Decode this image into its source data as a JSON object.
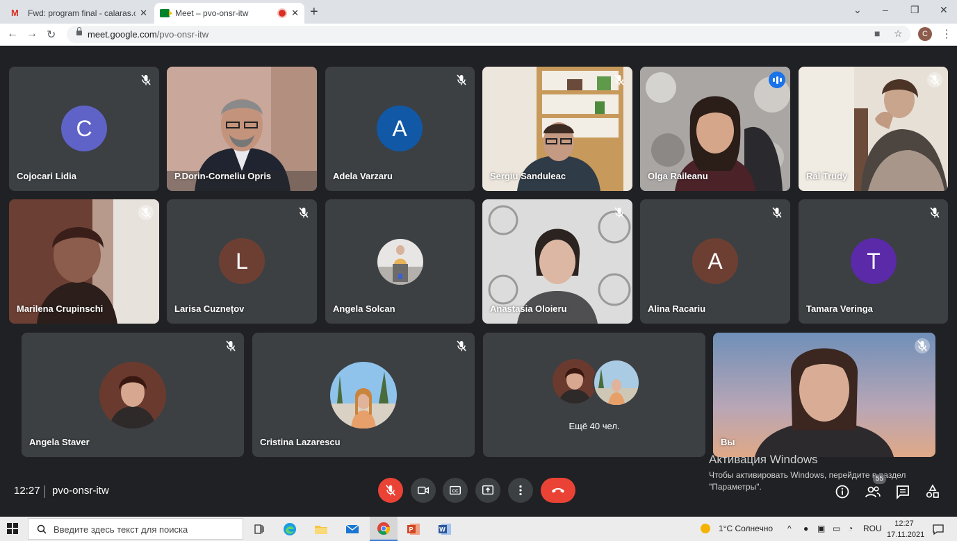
{
  "browser": {
    "tabs": [
      {
        "title": "Fwd: program final - calaras.carol"
      },
      {
        "title": "Meet – pvo-onsr-itw"
      }
    ],
    "url_host": "meet.google.com",
    "url_path": "/pvo-onsr-itw",
    "profile_initial": "C"
  },
  "meet": {
    "tiles": [
      {
        "name": "Cojocari Lidia",
        "initial": "C",
        "color": "#5f63c8"
      },
      {
        "name": "P.Dorin-Corneliu Opris"
      },
      {
        "name": "Adela Varzaru",
        "initial": "A",
        "color": "#1158a7"
      },
      {
        "name": "Sergiu Sanduleac"
      },
      {
        "name": "Olga Raileanu",
        "speaking": true
      },
      {
        "name": "Ral Trudy"
      },
      {
        "name": "Marilena Crupinschi"
      },
      {
        "name": "Larisa Cuznețov",
        "initial": "L",
        "color": "#6d3f33"
      },
      {
        "name": "Angela Solcan"
      },
      {
        "name": "Anastasia Oloieru"
      },
      {
        "name": "Alina Racariu",
        "initial": "A",
        "color": "#6d3f33"
      },
      {
        "name": "Tamara Veringa",
        "initial": "T",
        "color": "#5a2aa8"
      },
      {
        "name": "Angela Staver"
      },
      {
        "name": "Cristina Lazarescu"
      },
      {
        "more_label": "Ещё 40 чел."
      },
      {
        "name": "Вы"
      }
    ],
    "time": "12:27",
    "meeting_code": "pvo-onsr-itw",
    "participants_count": "55",
    "controls": [
      "mic-off",
      "camera",
      "captions",
      "present",
      "more",
      "hang-up"
    ]
  },
  "watermark": {
    "title": "Активация Windows",
    "line1": "Чтобы активировать Windows, перейдите в раздел",
    "line2": "\"Параметры\"."
  },
  "taskbar": {
    "search_placeholder": "Введите здесь текст для поиска",
    "weather": "1°C  Солнечно",
    "lang": "ROU",
    "time": "12:27",
    "date": "17.11.2021"
  },
  "colors": {
    "speaking_border": "#8ab4f8",
    "hangup": "#ea4335",
    "stage_bg": "#202124",
    "tile_bg": "#3c4043"
  }
}
